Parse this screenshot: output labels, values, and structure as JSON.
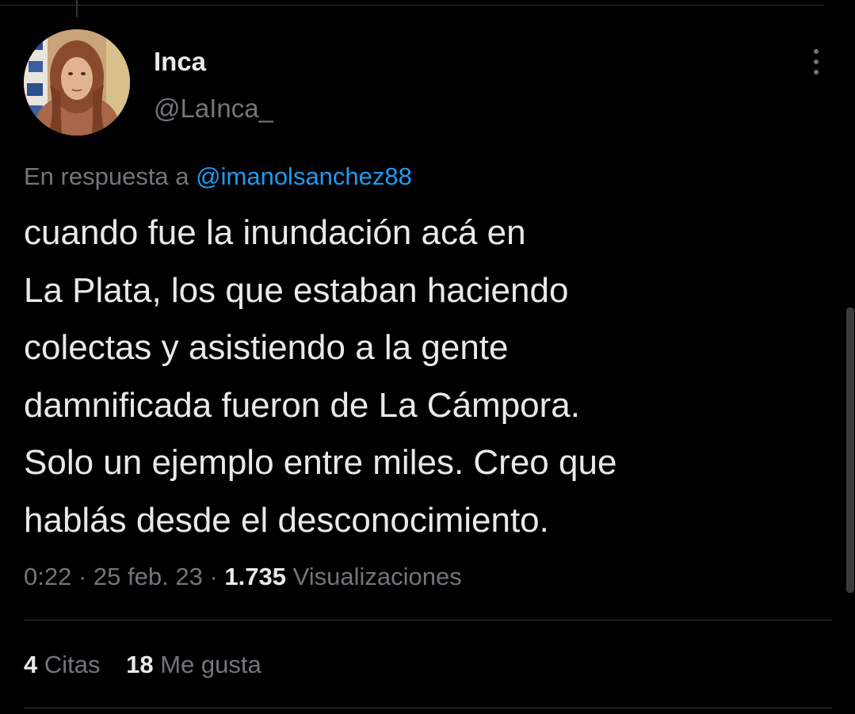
{
  "tweet": {
    "author": {
      "display_name": "Inca",
      "handle": "@LaInca_"
    },
    "reply_to": {
      "prefix": "En respuesta a",
      "mention": "@imanolsanchez88"
    },
    "text_lines": [
      "cuando fue la inundación acá en",
      "La Plata, los que estaban haciendo",
      "colectas y asistiendo a la gente",
      "damnificada fueron de La Cámpora.",
      "Solo un ejemplo entre miles. Creo que",
      "hablás desde el desconocimiento."
    ],
    "meta": {
      "time": "0:22",
      "separator": "·",
      "date": "25 feb. 23",
      "views_count": "1.735",
      "views_label": "Visualizaciones"
    },
    "stats": {
      "quotes_count": "4",
      "quotes_label": "Citas",
      "likes_count": "18",
      "likes_label": "Me gusta"
    }
  },
  "icons": {
    "more": "more-vertical-icon"
  },
  "colors": {
    "background": "#000000",
    "text_primary": "#e7e9ea",
    "text_secondary": "#71767b",
    "link": "#1d9bf0",
    "divider": "#2f3336"
  }
}
